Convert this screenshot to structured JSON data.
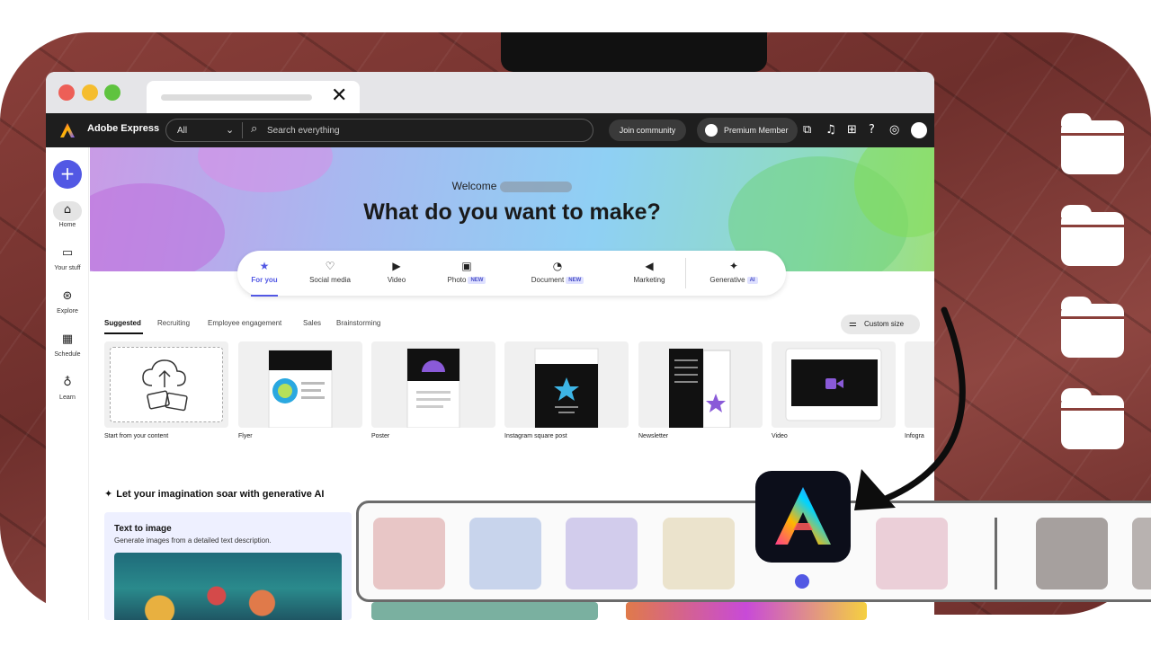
{
  "browser": {
    "traffic_lights": [
      "#ed5f57",
      "#f5bd2e",
      "#5fc33f"
    ],
    "close_glyph": "✕"
  },
  "topbar": {
    "brand": "Adobe Express",
    "search_scope": "All",
    "search_placeholder": "Search everything",
    "join_label": "Join community",
    "premium_label": "Premium Member",
    "icons": [
      "share-icon",
      "bell-icon",
      "apps-grid-icon",
      "help-icon",
      "creative-cloud-icon",
      "avatar"
    ]
  },
  "rail": {
    "items": [
      {
        "label": "Home",
        "icon": "home-icon"
      },
      {
        "label": "Your stuff",
        "icon": "folder-icon"
      },
      {
        "label": "Explore",
        "icon": "compass-icon"
      },
      {
        "label": "Schedule",
        "icon": "calendar-icon"
      },
      {
        "label": "Learn",
        "icon": "lightbulb-icon"
      }
    ]
  },
  "hero": {
    "welcome": "Welcome",
    "headline": "What do you want to make?"
  },
  "categories": [
    {
      "label": "For you",
      "icon": "star-icon",
      "active": true
    },
    {
      "label": "Social media",
      "icon": "thumbs-up-icon"
    },
    {
      "label": "Video",
      "icon": "play-icon"
    },
    {
      "label": "Photo",
      "icon": "photo-icon",
      "badge": "NEW"
    },
    {
      "label": "Document",
      "icon": "document-icon",
      "badge": "NEW"
    },
    {
      "label": "Marketing",
      "icon": "megaphone-icon"
    },
    {
      "label": "Generative",
      "icon": "sparkle-icon",
      "badge": "AI"
    }
  ],
  "filters": [
    "Suggested",
    "Recruiting",
    "Employee engagement",
    "Sales",
    "Brainstorming"
  ],
  "custom_size_label": "Custom size",
  "templates": [
    "Start from your content",
    "Flyer",
    "Poster",
    "Instagram square post",
    "Newsletter",
    "Video",
    "Infogra"
  ],
  "generative": {
    "title": "Let your imagination soar with generative AI",
    "card_title": "Text to image",
    "card_desc": "Generate images from a detailed text description."
  },
  "dock": {
    "tile_colors": [
      "#e8c6c6",
      "#c8d4ec",
      "#d2ccec",
      "#ebe3cc",
      "#ebcfd8",
      "#a6a09e",
      "#b8b2b0"
    ],
    "accent": "#5258e4"
  }
}
